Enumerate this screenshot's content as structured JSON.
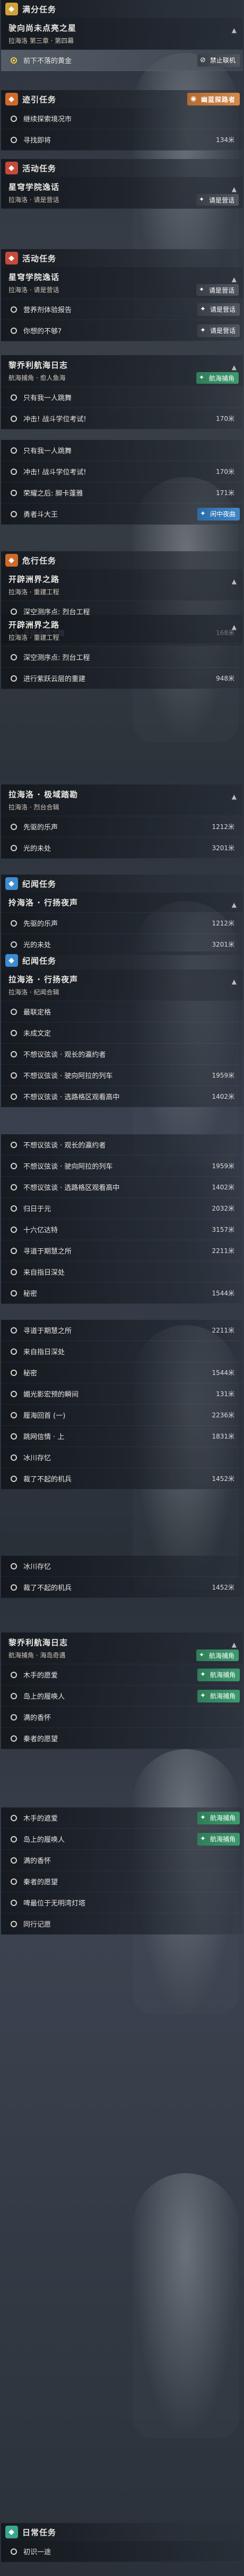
{
  "app": {
    "title": "任务日志"
  },
  "icons": {
    "category": "quest-category-icon",
    "step_dot": "waypoint-dot-icon",
    "tag_vision": "vision-eye-icon",
    "tag_nav": "navigation-icon",
    "tag_lock": "lock-icon",
    "collapse": "chevron-up-icon",
    "expand": "chevron-down-icon"
  },
  "colors": {
    "accent": "#f0c850",
    "tag_green": "#3d9a6e",
    "tag_blue": "#3f87c6"
  },
  "sections": [
    {
      "cat": {
        "label": "满分任务"
      },
      "quest": {
        "title": "驶向尚未点亮之星",
        "sub": "拉海洛 第三章 · 第四幕"
      },
      "steps": [
        {
          "label": "前下不落的黄金",
          "tag": "禁止联机",
          "active": true
        }
      ]
    },
    {
      "cat": {
        "label": "迹引任务",
        "tag": "幽蓝探路者"
      },
      "steps": [
        {
          "label": "继续探索境况市"
        },
        {
          "label": "寻找即将",
          "dist": "134米"
        }
      ]
    },
    {
      "cat": {
        "label": "活动任务"
      },
      "quest": {
        "title": "星穹学院逸话",
        "sub": "拉海洛 · 请是营话",
        "tag": "请是营话"
      },
      "steps": []
    },
    {
      "cat": {
        "label": "活动任务"
      },
      "quest": {
        "title": "星穹学院逸话",
        "sub": "拉海洛 · 请是营话",
        "tag": "请是营话"
      },
      "steps": [
        {
          "label": "营养剂体验报告",
          "tag": "请是营话"
        },
        {
          "label": "你想的不够?",
          "tag": "请是营话"
        }
      ]
    },
    {
      "quest": {
        "title": "黎乔利航海日志",
        "sub": "航海捕角 · 愈人鱼海",
        "tag": "航海捕角"
      },
      "steps": [
        {
          "label": "只有我一人跳舞"
        },
        {
          "label": "冲击! 战斗学位考试!",
          "dist": "170米"
        }
      ]
    },
    {
      "steps": [
        {
          "label": "只有我一人跳舞"
        },
        {
          "label": "冲击! 战斗学位考试!",
          "dist": "170米"
        },
        {
          "label": "荣耀之后: 脚卡蓬雅",
          "dist": "171米"
        },
        {
          "label": "勇者斗大王",
          "tag": "闲中夜曲"
        }
      ]
    },
    {
      "cat": {
        "label": "危行任务"
      },
      "quest": {
        "title": "开辟洲界之路",
        "sub": "拉海洛 · 重建工程"
      },
      "steps": [
        {
          "label": "深空测序点: 烈台工程"
        },
        {
          "label": "开辟洲界之路",
          "dist": "168米"
        }
      ]
    },
    {
      "quest": {
        "title": "开辟洲界之路",
        "sub": "拉海洛 · 重建工程"
      },
      "steps": [
        {
          "label": "深空测序点: 烈台工程"
        },
        {
          "label": "进行紫跃云层的重建",
          "dist": "948米"
        }
      ]
    },
    {
      "quest": {
        "title": "拉海洛 · 极域踏勘",
        "sub": "拉海洛 · 烈台合辑"
      },
      "steps": [
        {
          "label": "先驱的乐声",
          "dist": "1212米"
        },
        {
          "label": "光的未处",
          "dist": "3201米"
        }
      ]
    },
    {
      "cat": {
        "label": "纪闻任务"
      },
      "quest": {
        "title": "拎海洛 · 行扬夜声",
        "sub": ""
      },
      "steps": [
        {
          "label": "先驱的乐声",
          "dist": "1212米"
        },
        {
          "label": "光的未处",
          "dist": "3201米"
        }
      ]
    },
    {
      "cat": {
        "label": "纪闻任务"
      },
      "quest": {
        "title": "拉海洛 · 行扬夜声",
        "sub": "拉海洛 · 纪闻合辑"
      },
      "steps": [
        {
          "label": "最联定格"
        },
        {
          "label": "未成文定",
          "dist": ""
        },
        {
          "label": "不想议弦谈 · 观长的瀛约者"
        },
        {
          "label": "不想议弦谈 · 驶向阿拉的列车",
          "dist": "1959米"
        },
        {
          "label": "不想议弦谈 · 选路格区观看高中",
          "dist": "1402米"
        }
      ]
    },
    {
      "steps": [
        {
          "label": "不想议弦谈 · 观长的瀛约者"
        },
        {
          "label": "不想议弦谈 · 驶向阿拉的列车",
          "dist": "1959米"
        },
        {
          "label": "不想议弦谈 · 选路格区观看高中",
          "dist": "1402米"
        },
        {
          "label": "归日于元",
          "dist": "2032米"
        },
        {
          "label": "十六亿达特",
          "dist": "3157米"
        },
        {
          "label": "寻道于期慧之所",
          "dist": "2211米"
        },
        {
          "label": "来自指日深处"
        },
        {
          "label": "秘密",
          "dist": "1544米"
        }
      ]
    },
    {
      "steps": [
        {
          "label": "寻道于期慧之所",
          "dist": "2211米"
        },
        {
          "label": "来自指日深处"
        },
        {
          "label": "秘密",
          "dist": "1544米"
        },
        {
          "label": "媚光影宏预的瞬间",
          "dist": "131米"
        },
        {
          "label": "履海回首 (一)",
          "dist": "2236米"
        },
        {
          "label": "跳网信情 · 上",
          "dist": "1831米"
        },
        {
          "label": "冰川存忆"
        },
        {
          "label": "裁了不起的机兵",
          "dist": "1452米"
        }
      ]
    },
    {
      "steps": [
        {
          "label": "冰川存忆"
        },
        {
          "label": "裁了不起的机兵",
          "dist": "1452米"
        }
      ]
    },
    {
      "quest": {
        "title": "黎乔利航海日志",
        "sub": "航海捕角 · 海岛奇遇",
        "tag": "航海捕角"
      },
      "steps": [
        {
          "label": "木手的愿爱",
          "tag": "航海捕角"
        },
        {
          "label": "岛上的履唤人",
          "tag": "航海捕角"
        },
        {
          "label": "满的香怀"
        },
        {
          "label": "秦者的愿望"
        }
      ]
    },
    {
      "steps": [
        {
          "label": "木手的遮爱",
          "tag": "航海捕角"
        },
        {
          "label": "岛上的履唤人",
          "tag": "航海捕角"
        },
        {
          "label": "满的香怀"
        },
        {
          "label": "秦者的愿望"
        },
        {
          "label": "啤最位于无明湾灯塔"
        },
        {
          "label": "同行记愿"
        }
      ]
    },
    {
      "cat": {
        "label": "日常任务"
      },
      "steps": [
        {
          "label": "初识一途"
        }
      ]
    }
  ]
}
